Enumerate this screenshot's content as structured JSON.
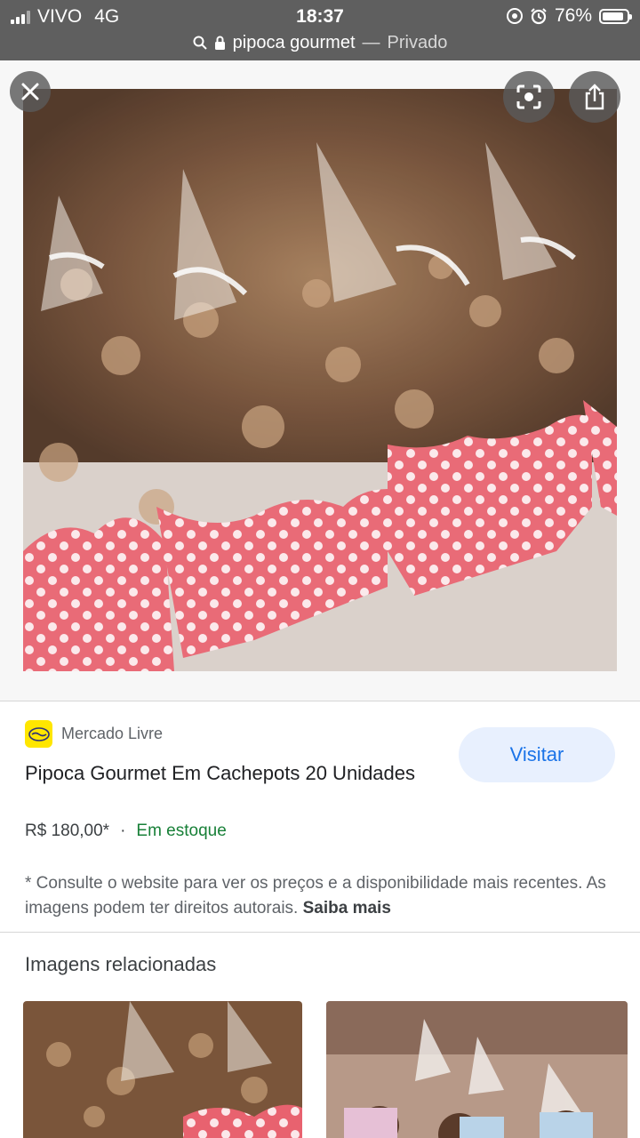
{
  "status_bar": {
    "carrier": "VIVO",
    "network": "4G",
    "time": "18:37",
    "battery": "76%"
  },
  "url_bar": {
    "query": "pipoca gourmet",
    "separator": "—",
    "mode": "Privado"
  },
  "viewer": {
    "close_icon": "close-icon",
    "lens_icon": "lens-icon",
    "share_icon": "share-icon"
  },
  "product": {
    "source": "Mercado Livre",
    "title": "Pipoca Gourmet Em Cachepots 20 Unidades",
    "price": "R$ 180,00*",
    "dot": "·",
    "availability": "Em estoque",
    "visit_label": "Visitar",
    "disclaimer": "* Consulte o website para ver os preços e a disponibilidade mais recentes. As imagens podem ter direitos autorais.",
    "learn_more": "Saiba mais"
  },
  "related": {
    "title": "Imagens relacionadas"
  },
  "colors": {
    "brand_yellow": "#ffe600",
    "link_blue": "#1a73e8",
    "stock_green": "#188038",
    "polka_pink": "#e8626f"
  }
}
